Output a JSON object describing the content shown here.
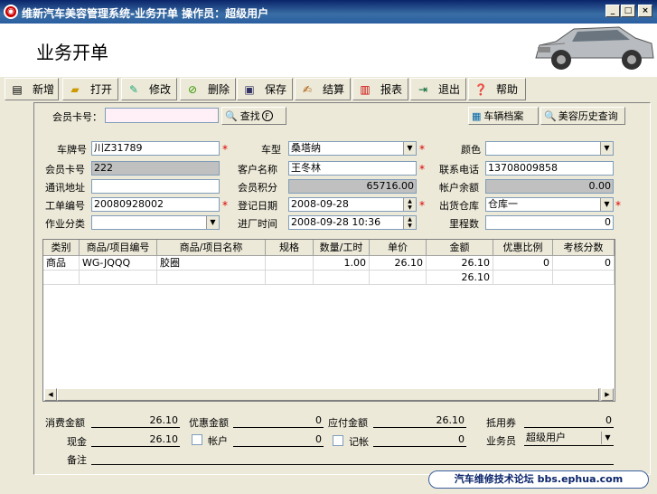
{
  "window": {
    "title": "维新汽车美容管理系统-业务开单  操作员：超级用户",
    "app_icon": "logo",
    "min": "_",
    "max": "□",
    "close": "×"
  },
  "page_title": "业务开单",
  "toolbar": [
    {
      "label": "新增",
      "icon": "new-icon"
    },
    {
      "label": "打开",
      "icon": "open-folder-icon"
    },
    {
      "label": "修改",
      "icon": "edit-icon"
    },
    {
      "label": "删除",
      "icon": "delete-icon"
    },
    {
      "label": "保存",
      "icon": "save-icon"
    },
    {
      "label": "结算",
      "icon": "settle-icon"
    },
    {
      "label": "报表",
      "icon": "report-icon"
    },
    {
      "label": "退出",
      "icon": "exit-icon"
    },
    {
      "label": "帮助",
      "icon": "help-icon"
    }
  ],
  "member": {
    "label": "会员卡号：",
    "value": "",
    "find": "查找",
    "find_key": "F",
    "vehicle_archive": "车辆档案",
    "history": "美容历史查询"
  },
  "form": {
    "plate": {
      "label": "车牌号",
      "value": "川Z31789"
    },
    "car_type": {
      "label": "车型",
      "value": "桑塔纳"
    },
    "color": {
      "label": "颜色",
      "value": ""
    },
    "card_no": {
      "label": "会员卡号",
      "value": "222"
    },
    "customer": {
      "label": "客户名称",
      "value": "王冬林"
    },
    "phone": {
      "label": "联系电话",
      "value": "13708009858"
    },
    "address": {
      "label": "通讯地址",
      "value": ""
    },
    "points": {
      "label": "会员积分",
      "value": "65716.00"
    },
    "balance": {
      "label": "帐户余额",
      "value": "0.00"
    },
    "order_no": {
      "label": "工单编号",
      "value": "20080928002"
    },
    "reg_date": {
      "label": "登记日期",
      "value": "2008-09-28"
    },
    "warehouse": {
      "label": "出货仓库",
      "value": "仓库一"
    },
    "category": {
      "label": "作业分类",
      "value": ""
    },
    "in_time": {
      "label": "进厂时间",
      "value": "2008-09-28 10:36"
    },
    "mileage": {
      "label": "里程数",
      "value": "0"
    },
    "required_mark": "*"
  },
  "grid": {
    "columns": [
      "类别",
      "商品/项目编号",
      "商品/项目名称",
      "规格",
      "数量/工时",
      "单价",
      "金额",
      "优惠比例",
      "考核分数"
    ],
    "rows": [
      [
        "商品",
        "WG-JQQQ",
        "胶圈",
        "",
        "1.00",
        "26.10",
        "26.10",
        "0",
        "0"
      ]
    ],
    "total_amount": "26.10"
  },
  "summary": {
    "consume": {
      "label": "消费金额",
      "value": "26.10"
    },
    "discount": {
      "label": "优惠金额",
      "value": "0"
    },
    "payable": {
      "label": "应付金额",
      "value": "26.10"
    },
    "voucher": {
      "label": "抵用券",
      "value": "0"
    },
    "cash": {
      "label": "现金",
      "value": "26.10"
    },
    "account": {
      "label": "帐户",
      "value": "0"
    },
    "credit": {
      "label": "记帐",
      "value": "0"
    },
    "salesman": {
      "label": "业务员",
      "value": "超级用户"
    },
    "remark": {
      "label": "备注",
      "value": ""
    }
  },
  "watermark": "汽车维修技术论坛 bbs.ephua.com"
}
